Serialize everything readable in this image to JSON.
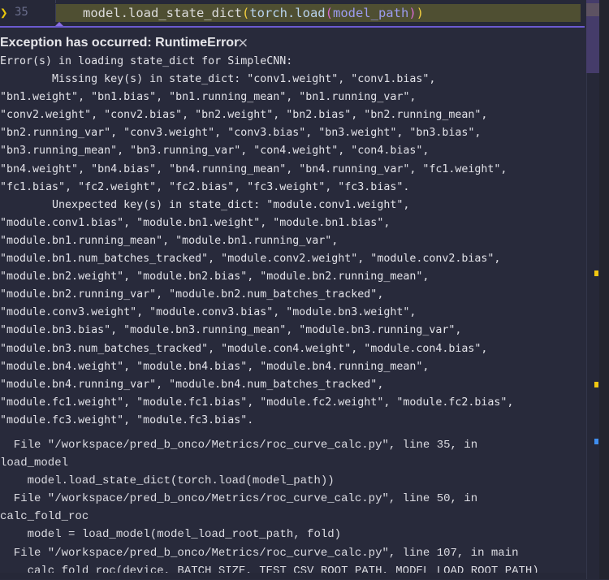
{
  "editor": {
    "current_line_number": "35",
    "current_line": {
      "indent": "    ",
      "prefix": "model.load_state_dict",
      "paren_open_1": "(",
      "call": "torch.load",
      "paren_open_2": "(",
      "arg": "model_path",
      "paren_close_2": ")",
      "paren_close_1": ")"
    }
  },
  "exception": {
    "title": "Exception has occurred: RuntimeError",
    "close_icon": "×",
    "message_lines": [
      "Error(s) in loading state_dict for SimpleCNN:",
      "\tMissing key(s) in state_dict: \"conv1.weight\", \"conv1.bias\",",
      "\"bn1.weight\", \"bn1.bias\", \"bn1.running_mean\", \"bn1.running_var\",",
      "\"conv2.weight\", \"conv2.bias\", \"bn2.weight\", \"bn2.bias\", \"bn2.running_mean\",",
      "\"bn2.running_var\", \"conv3.weight\", \"conv3.bias\", \"bn3.weight\", \"bn3.bias\",",
      "\"bn3.running_mean\", \"bn3.running_var\", \"con4.weight\", \"con4.bias\",",
      "\"bn4.weight\", \"bn4.bias\", \"bn4.running_mean\", \"bn4.running_var\", \"fc1.weight\",",
      "\"fc1.bias\", \"fc2.weight\", \"fc2.bias\", \"fc3.weight\", \"fc3.bias\".",
      "\tUnexpected key(s) in state_dict: \"module.conv1.weight\",",
      "\"module.conv1.bias\", \"module.bn1.weight\", \"module.bn1.bias\",",
      "\"module.bn1.running_mean\", \"module.bn1.running_var\",",
      "\"module.bn1.num_batches_tracked\", \"module.conv2.weight\", \"module.conv2.bias\",",
      "\"module.bn2.weight\", \"module.bn2.bias\", \"module.bn2.running_mean\",",
      "\"module.bn2.running_var\", \"module.bn2.num_batches_tracked\",",
      "\"module.conv3.weight\", \"module.conv3.bias\", \"module.bn3.weight\",",
      "\"module.bn3.bias\", \"module.bn3.running_mean\", \"module.bn3.running_var\",",
      "\"module.bn3.num_batches_tracked\", \"module.con4.weight\", \"module.con4.bias\",",
      "\"module.bn4.weight\", \"module.bn4.bias\", \"module.bn4.running_mean\",",
      "\"module.bn4.running_var\", \"module.bn4.num_batches_tracked\",",
      "\"module.fc1.weight\", \"module.fc1.bias\", \"module.fc2.weight\", \"module.fc2.bias\",",
      "\"module.fc3.weight\", \"module.fc3.bias\"."
    ],
    "traceback_lines": [
      "  File \"/workspace/pred_b_onco/Metrics/roc_curve_calc.py\", line 35, in",
      "load_model",
      "    model.load_state_dict(torch.load(model_path))",
      "  File \"/workspace/pred_b_onco/Metrics/roc_curve_calc.py\", line 50, in",
      "calc_fold_roc",
      "    model = load_model(model_load_root_path, fold)",
      "  File \"/workspace/pred_b_onco/Metrics/roc_curve_calc.py\", line 107, in main",
      "    calc_fold_roc(device, BATCH_SIZE, TEST_CSV_ROOT_PATH, MODEL_LOAD_ROOT_PATH)"
    ]
  },
  "scrollbar_markers": [
    {
      "color": "#f2c811"
    },
    {
      "color": "#f2c811"
    },
    {
      "color": "#3f8ef0"
    }
  ]
}
